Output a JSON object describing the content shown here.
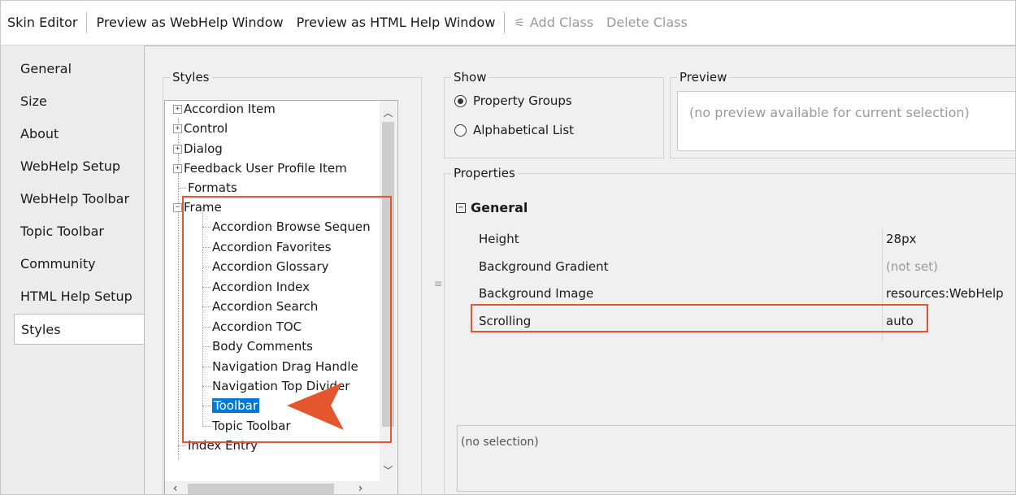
{
  "toolbar": {
    "skin_editor": "Skin Editor",
    "preview_webhelp": "Preview as WebHelp Window",
    "preview_htmlhelp": "Preview as HTML Help Window",
    "add_class": "Add Class",
    "delete_class": "Delete Class"
  },
  "nav": {
    "items": [
      "General",
      "Size",
      "About",
      "WebHelp Setup",
      "WebHelp Toolbar",
      "Topic Toolbar",
      "Community",
      "HTML Help Setup",
      "Styles"
    ],
    "active": "Styles"
  },
  "styles_panel": {
    "legend": "Styles",
    "tree": {
      "collapsed": [
        "Accordion Item",
        "Control",
        "Dialog",
        "Feedback User Profile Item"
      ],
      "leaf_formats": "Formats",
      "expanded": "Frame",
      "children": [
        "Accordion Browse Sequen",
        "Accordion Favorites",
        "Accordion Glossary",
        "Accordion Index",
        "Accordion Search",
        "Accordion TOC",
        "Body Comments",
        "Navigation Drag Handle",
        "Navigation Top Divider",
        "Toolbar",
        "Topic Toolbar"
      ],
      "selected": "Toolbar",
      "after": "Index Entry"
    }
  },
  "show": {
    "legend": "Show",
    "options": [
      "Property Groups",
      "Alphabetical List"
    ],
    "selected": "Property Groups"
  },
  "preview": {
    "legend": "Preview",
    "message": "(no preview available for current selection)"
  },
  "properties": {
    "legend": "Properties",
    "category": "General",
    "rows": [
      {
        "name": "Height",
        "value": "28px"
      },
      {
        "name": "Background Gradient",
        "value": "(not set)"
      },
      {
        "name": "Background Image",
        "value": "resources:WebHelp"
      },
      {
        "name": "Scrolling",
        "value": "auto"
      }
    ],
    "description": "(no selection)"
  },
  "colors": {
    "selection": "#0078d7",
    "callout": "#e4572e"
  }
}
